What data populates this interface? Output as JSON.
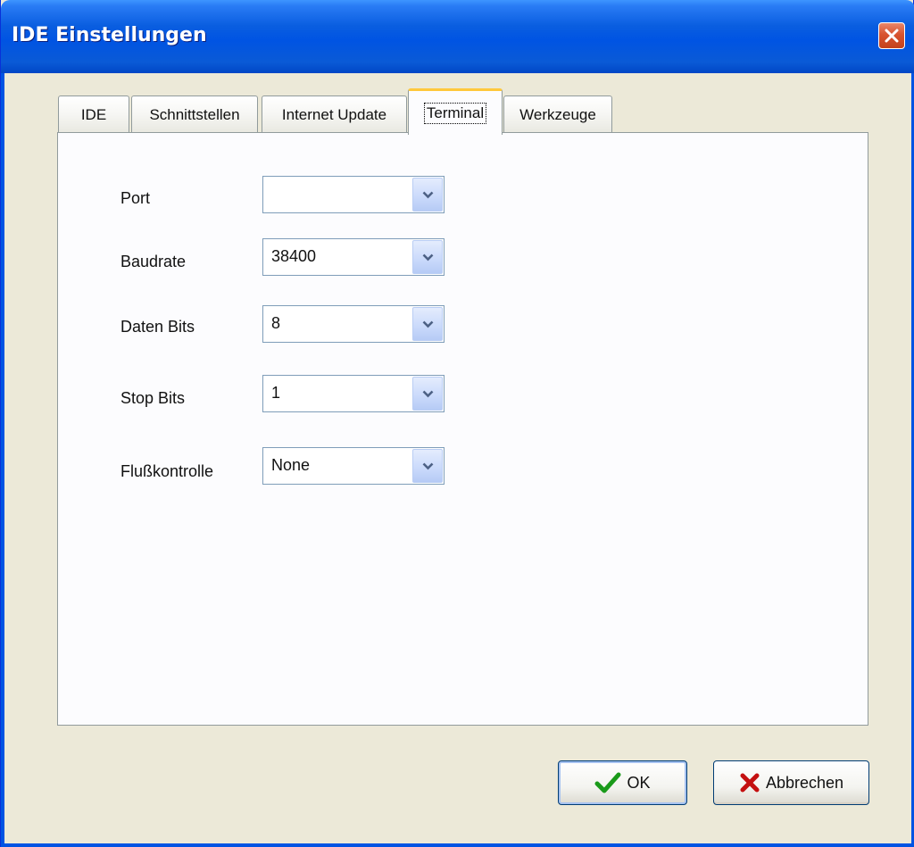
{
  "window": {
    "title": "IDE Einstellungen"
  },
  "tabs": [
    {
      "label": "IDE",
      "active": false
    },
    {
      "label": "Schnittstellen",
      "active": false
    },
    {
      "label": "Internet Update",
      "active": false
    },
    {
      "label": "Terminal",
      "active": true
    },
    {
      "label": "Werkzeuge",
      "active": false
    }
  ],
  "terminal": {
    "fields": [
      {
        "label": "Port",
        "value": ""
      },
      {
        "label": "Baudrate",
        "value": "38400"
      },
      {
        "label": "Daten Bits",
        "value": "8"
      },
      {
        "label": "Stop Bits",
        "value": "1"
      },
      {
        "label": "Flußkontrolle",
        "value": "None"
      }
    ]
  },
  "buttons": {
    "ok_label": "OK",
    "cancel_label": "Abbrechen"
  },
  "icons": {
    "close": "close-icon",
    "dropdown": "chevron-down-icon",
    "ok": "checkmark-icon",
    "cancel": "cross-icon"
  },
  "colors": {
    "titlebar": "#0054e3",
    "active_tab_highlight": "#ffc83c",
    "ok_icon": "#1a9a1a",
    "cancel_icon": "#c41010"
  }
}
